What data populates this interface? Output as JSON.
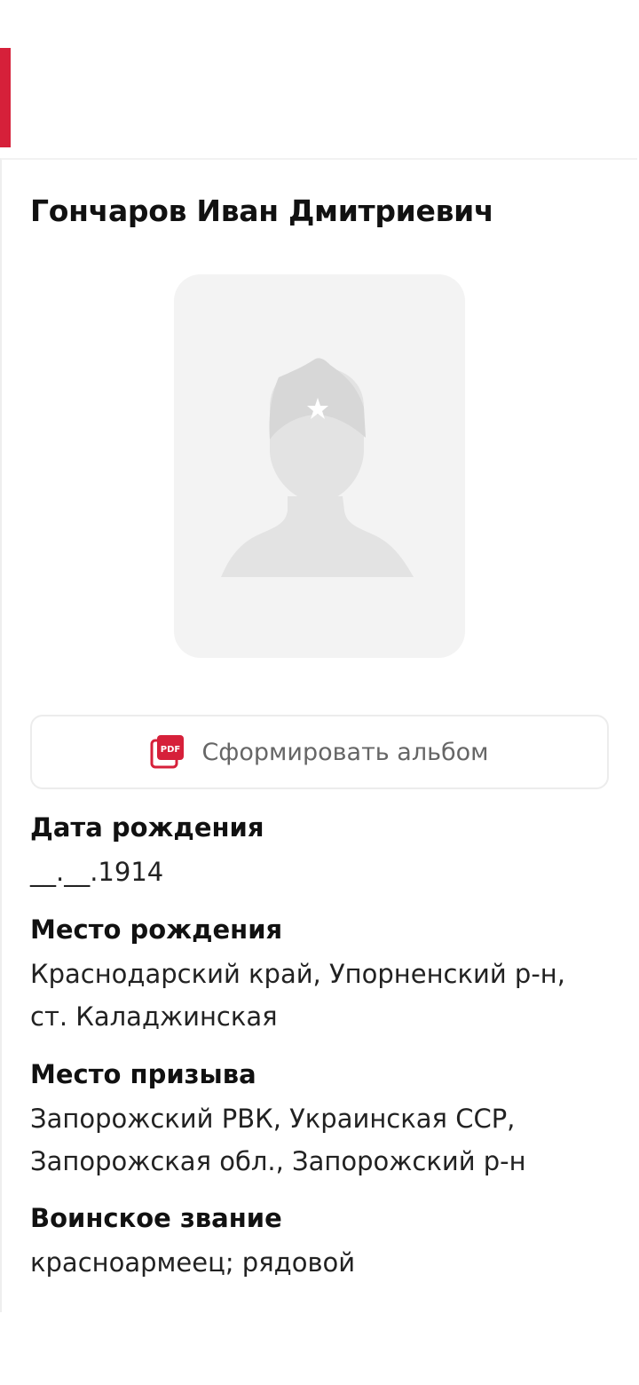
{
  "person": {
    "name": "Гончаров Иван Дмитриевич"
  },
  "album_button": {
    "icon": "pdf-icon",
    "icon_text": "PDF",
    "label": "Сформировать альбом",
    "accent": "#d6203a"
  },
  "fields": [
    {
      "title": "Дата рождения",
      "value": "__.__.1914"
    },
    {
      "title": "Место рождения",
      "value": "Краснодарский край, Упорненский р-н, ст. Каладжинская"
    },
    {
      "title": "Место призыва",
      "value": "Запорожский РВК, Украинская ССР, Запорожская обл., Запорожский р-н"
    },
    {
      "title": "Воинское звание",
      "value": "красноармеец; рядовой"
    }
  ],
  "colors": {
    "brand_red": "#d6203a",
    "placeholder_bg": "#f3f3f3",
    "silhouette": "#e3e3e3"
  }
}
